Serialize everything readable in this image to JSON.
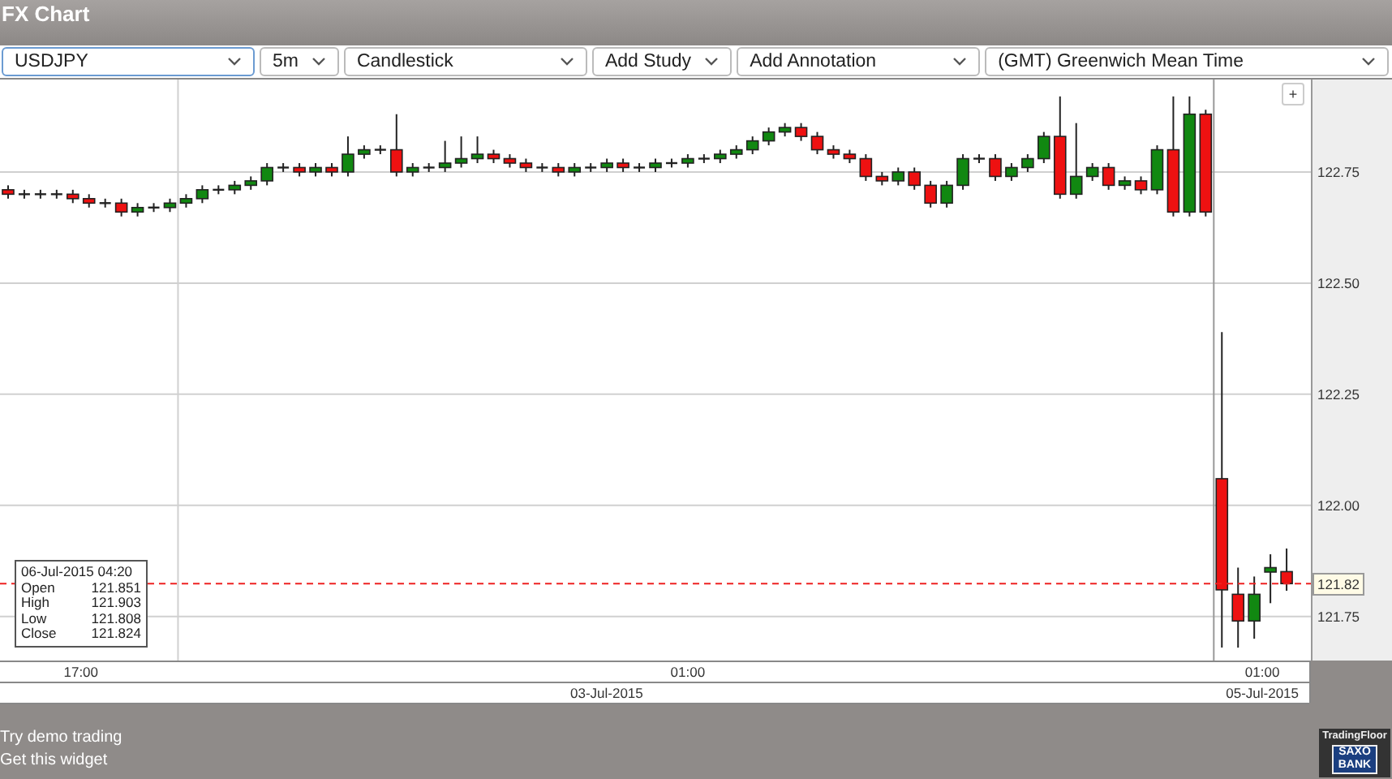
{
  "window": {
    "title": "FX Chart"
  },
  "toolbar": [
    {
      "value": "USDJPY",
      "kind": "wide"
    },
    {
      "value": "5m",
      "kind": "small"
    },
    {
      "value": "Candlestick",
      "kind": "medium"
    },
    {
      "value": "Add Study",
      "kind": "small"
    },
    {
      "value": "Add Annotation",
      "kind": "medium"
    },
    {
      "value": "(GMT) Greenwich Mean Time",
      "kind": "fill"
    }
  ],
  "zoom_button": "+",
  "chart": {
    "chart_data": {
      "type": "candlestick",
      "categories": [
        null,
        null,
        null,
        null,
        null,
        null,
        null,
        null,
        null,
        null,
        null,
        null,
        null,
        null,
        null,
        null,
        null,
        null,
        null,
        null,
        null,
        null,
        null,
        null,
        null,
        null,
        null,
        null,
        null,
        null,
        null,
        null,
        null,
        null,
        null,
        null,
        null,
        null,
        null,
        null,
        null,
        null,
        null,
        null,
        null,
        null,
        null,
        null,
        null,
        null,
        null,
        null,
        null,
        null,
        null,
        null,
        null,
        null,
        null,
        null,
        null,
        null,
        null,
        null,
        null,
        null,
        null,
        null,
        null,
        null,
        null,
        null,
        null,
        null,
        null,
        null,
        null,
        null,
        null,
        null
      ],
      "ohlc": [
        [
          122.71,
          122.72,
          122.69,
          122.7
        ],
        [
          122.7,
          122.71,
          122.69,
          122.7
        ],
        [
          122.7,
          122.71,
          122.69,
          122.7
        ],
        [
          122.7,
          122.71,
          122.69,
          122.7
        ],
        [
          122.7,
          122.71,
          122.68,
          122.69
        ],
        [
          122.69,
          122.7,
          122.67,
          122.68
        ],
        [
          122.68,
          122.69,
          122.67,
          122.68
        ],
        [
          122.68,
          122.69,
          122.65,
          122.66
        ],
        [
          122.66,
          122.68,
          122.65,
          122.67
        ],
        [
          122.67,
          122.68,
          122.66,
          122.67
        ],
        [
          122.67,
          122.69,
          122.66,
          122.68
        ],
        [
          122.68,
          122.7,
          122.67,
          122.69
        ],
        [
          122.69,
          122.72,
          122.68,
          122.71
        ],
        [
          122.71,
          122.72,
          122.7,
          122.71
        ],
        [
          122.71,
          122.73,
          122.7,
          122.72
        ],
        [
          122.72,
          122.74,
          122.71,
          122.73
        ],
        [
          122.73,
          122.77,
          122.72,
          122.76
        ],
        [
          122.76,
          122.77,
          122.75,
          122.76
        ],
        [
          122.76,
          122.77,
          122.74,
          122.75
        ],
        [
          122.75,
          122.77,
          122.74,
          122.76
        ],
        [
          122.76,
          122.77,
          122.74,
          122.75
        ],
        [
          122.75,
          122.83,
          122.74,
          122.79
        ],
        [
          122.79,
          122.81,
          122.78,
          122.8
        ],
        [
          122.8,
          122.81,
          122.79,
          122.8
        ],
        [
          122.8,
          122.88,
          122.74,
          122.75
        ],
        [
          122.75,
          122.77,
          122.74,
          122.76
        ],
        [
          122.76,
          122.77,
          122.75,
          122.76
        ],
        [
          122.76,
          122.82,
          122.75,
          122.77
        ],
        [
          122.77,
          122.83,
          122.76,
          122.78
        ],
        [
          122.78,
          122.83,
          122.77,
          122.79
        ],
        [
          122.79,
          122.8,
          122.77,
          122.78
        ],
        [
          122.78,
          122.79,
          122.76,
          122.77
        ],
        [
          122.77,
          122.78,
          122.75,
          122.76
        ],
        [
          122.76,
          122.77,
          122.75,
          122.76
        ],
        [
          122.76,
          122.77,
          122.74,
          122.75
        ],
        [
          122.75,
          122.77,
          122.74,
          122.76
        ],
        [
          122.76,
          122.77,
          122.75,
          122.76
        ],
        [
          122.76,
          122.78,
          122.75,
          122.77
        ],
        [
          122.77,
          122.78,
          122.75,
          122.76
        ],
        [
          122.76,
          122.77,
          122.75,
          122.76
        ],
        [
          122.76,
          122.78,
          122.75,
          122.77
        ],
        [
          122.77,
          122.78,
          122.76,
          122.77
        ],
        [
          122.77,
          122.79,
          122.76,
          122.78
        ],
        [
          122.78,
          122.79,
          122.77,
          122.78
        ],
        [
          122.78,
          122.8,
          122.77,
          122.79
        ],
        [
          122.79,
          122.81,
          122.78,
          122.8
        ],
        [
          122.8,
          122.83,
          122.79,
          122.82
        ],
        [
          122.82,
          122.85,
          122.81,
          122.84
        ],
        [
          122.84,
          122.86,
          122.83,
          122.85
        ],
        [
          122.85,
          122.86,
          122.82,
          122.83
        ],
        [
          122.83,
          122.84,
          122.79,
          122.8
        ],
        [
          122.8,
          122.81,
          122.78,
          122.79
        ],
        [
          122.79,
          122.8,
          122.77,
          122.78
        ],
        [
          122.78,
          122.79,
          122.73,
          122.74
        ],
        [
          122.74,
          122.75,
          122.72,
          122.73
        ],
        [
          122.73,
          122.76,
          122.72,
          122.75
        ],
        [
          122.75,
          122.76,
          122.71,
          122.72
        ],
        [
          122.72,
          122.73,
          122.67,
          122.68
        ],
        [
          122.68,
          122.73,
          122.67,
          122.72
        ],
        [
          122.72,
          122.79,
          122.71,
          122.78
        ],
        [
          122.78,
          122.79,
          122.77,
          122.78
        ],
        [
          122.78,
          122.79,
          122.73,
          122.74
        ],
        [
          122.74,
          122.77,
          122.73,
          122.76
        ],
        [
          122.76,
          122.79,
          122.75,
          122.78
        ],
        [
          122.78,
          122.84,
          122.77,
          122.83
        ],
        [
          122.83,
          122.92,
          122.69,
          122.7
        ],
        [
          122.7,
          122.86,
          122.69,
          122.74
        ],
        [
          122.74,
          122.77,
          122.73,
          122.76
        ],
        [
          122.76,
          122.77,
          122.71,
          122.72
        ],
        [
          122.72,
          122.74,
          122.71,
          122.73
        ],
        [
          122.73,
          122.74,
          122.7,
          122.71
        ],
        [
          122.71,
          122.81,
          122.7,
          122.8
        ],
        [
          122.8,
          122.92,
          122.65,
          122.66
        ],
        [
          122.66,
          122.92,
          122.65,
          122.88
        ],
        [
          122.88,
          122.89,
          122.65,
          122.66
        ],
        [
          122.06,
          122.39,
          121.68,
          121.81
        ],
        [
          121.8,
          121.86,
          121.68,
          121.74
        ],
        [
          121.74,
          121.84,
          121.7,
          121.8
        ],
        [
          121.85,
          121.89,
          121.78,
          121.86
        ],
        [
          121.851,
          121.903,
          121.808,
          121.824
        ]
      ],
      "grid": true,
      "ref_lines": [
        {
          "axis": "y",
          "value": 121.824,
          "color": "#ee2222"
        }
      ],
      "ylim": [
        121.651,
        122.958
      ],
      "yticks": [
        {
          "value": 122.75,
          "label": "122.75"
        },
        {
          "value": 122.5,
          "label": "122.50"
        },
        {
          "value": 122.25,
          "label": "122.25"
        },
        {
          "value": 122,
          "label": "122.00"
        },
        {
          "value": 121.75,
          "label": "121.75"
        }
      ]
    }
  },
  "x_axis_times": [
    "17:00",
    "01:00",
    "01:00"
  ],
  "crosshair_price": "121.82",
  "x_axis_dates": [
    "03-Jul-2015",
    "05-Jul-2015"
  ],
  "tooltip": {
    "date": "06-Jul-2015 04:20",
    "rows": [
      {
        "label": "Open",
        "value": "121.851"
      },
      {
        "label": "High",
        "value": "121.903"
      },
      {
        "label": "Low",
        "value": "121.808"
      },
      {
        "label": "Close",
        "value": "121.824"
      }
    ]
  },
  "footer_links": [
    "Try demo trading",
    "Get this widget"
  ],
  "logo": {
    "top": "TradingFloor",
    "lines": [
      "SAXO",
      "BANK"
    ]
  }
}
